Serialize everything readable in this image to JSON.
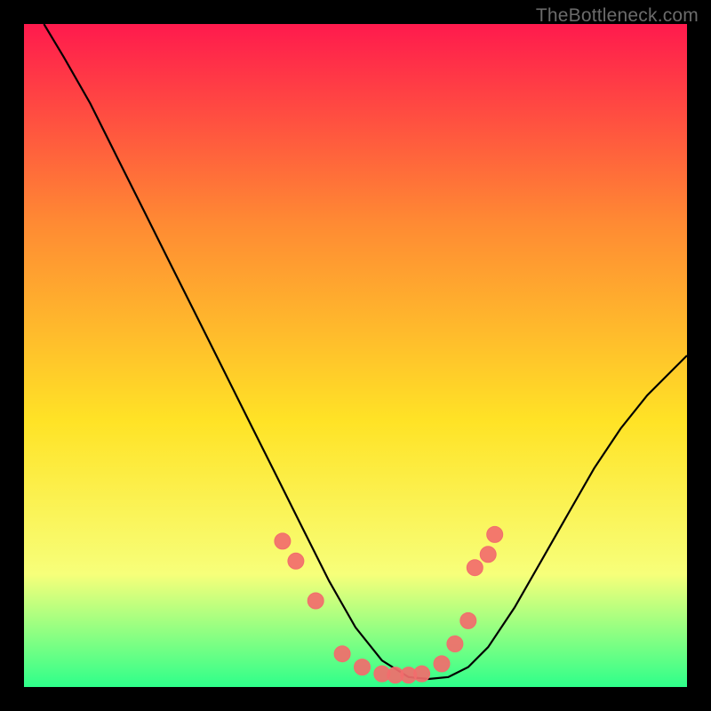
{
  "watermark": "TheBottleneck.com",
  "chart_data": {
    "type": "line",
    "title": "",
    "xlabel": "",
    "ylabel": "",
    "xlim": [
      0,
      100
    ],
    "ylim": [
      0,
      100
    ],
    "grid": false,
    "legend": false,
    "background_gradient": {
      "top": "#ff1a4d",
      "upper_mid": "#ff8a33",
      "mid": "#ffe326",
      "lower_mid": "#f7ff7a",
      "bottom": "#2eff8a"
    },
    "series": [
      {
        "name": "curve",
        "stroke": "#000000",
        "x": [
          3,
          6,
          10,
          14,
          18,
          22,
          26,
          30,
          34,
          38,
          42,
          46,
          50,
          54,
          58,
          61,
          64,
          67,
          70,
          74,
          78,
          82,
          86,
          90,
          94,
          98,
          100
        ],
        "y": [
          100,
          95,
          88,
          80,
          72,
          64,
          56,
          48,
          40,
          32,
          24,
          16,
          9,
          4,
          1.5,
          1.2,
          1.5,
          3,
          6,
          12,
          19,
          26,
          33,
          39,
          44,
          48,
          50
        ]
      }
    ],
    "markers": {
      "stroke": "#f26d6d",
      "fill": "#f26d6d",
      "radius_px": 9,
      "x": [
        39,
        41,
        44,
        48,
        51,
        54,
        56,
        58,
        60,
        63,
        65,
        67,
        68,
        70,
        71
      ],
      "y": [
        22,
        19,
        13,
        5,
        3,
        2,
        1.8,
        1.8,
        2,
        3.5,
        6.5,
        10,
        18,
        20,
        23
      ]
    }
  }
}
